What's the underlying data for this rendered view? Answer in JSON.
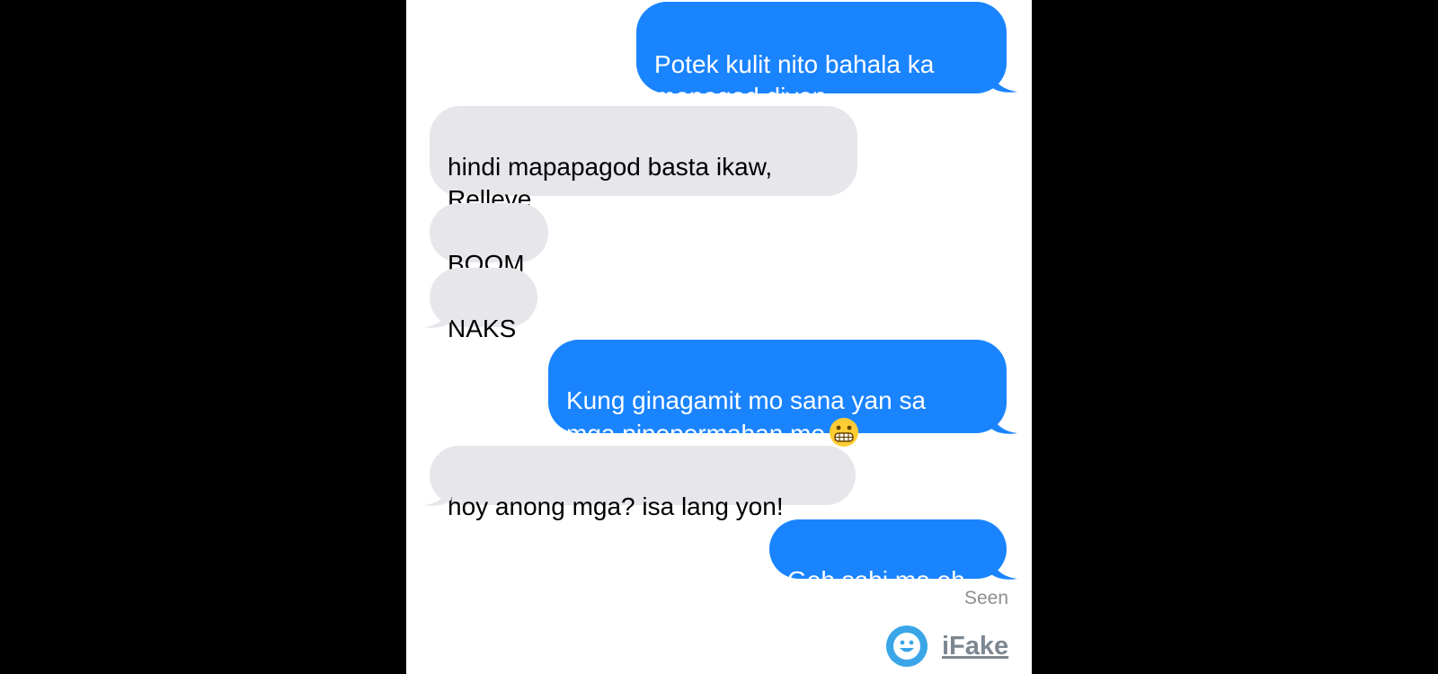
{
  "conversation": {
    "messages": [
      {
        "direction": "outgoing",
        "text": "Potek kulit nito bahala ka\nmapagod diyan"
      },
      {
        "direction": "incoming",
        "text": "hindi mapapagod basta ikaw,\nRelleve"
      },
      {
        "direction": "incoming",
        "text": "BOOM"
      },
      {
        "direction": "incoming",
        "text": "NAKS"
      },
      {
        "direction": "outgoing",
        "text": "Kung ginagamit mo sana yan sa\nmga pinopormahan mo",
        "emoji": "grimacing-face-emoji"
      },
      {
        "direction": "incoming",
        "text": "hoy anong mga? isa lang yon!"
      },
      {
        "direction": "outgoing",
        "text": "Geh sabi mo eh"
      }
    ],
    "status": "Seen"
  },
  "watermark": {
    "logo_icon": "smiley-face-icon",
    "text": "iFake"
  },
  "colors": {
    "outgoing_bubble": "#1a84ff",
    "incoming_bubble": "#e6e6eb",
    "outgoing_text": "#ffffff",
    "incoming_text": "#000000",
    "status_text": "#8e8e93",
    "logo_blue": "#3aa6e8",
    "watermark_text": "#7d8791"
  }
}
